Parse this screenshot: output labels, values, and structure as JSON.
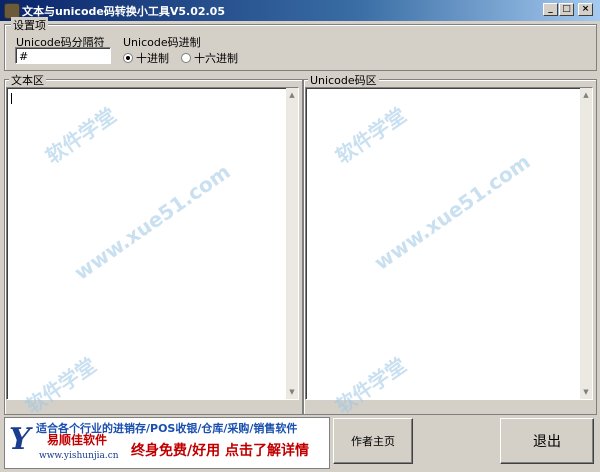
{
  "window": {
    "title": "文本与unicode码转换小工具V5.02.05"
  },
  "settings": {
    "legend": "设置项",
    "separator_label": "Unicode码分隔符",
    "separator_value": "#",
    "radix_label": "Unicode码进制",
    "radix_options": [
      {
        "label": "十进制",
        "selected": true
      },
      {
        "label": "十六进制",
        "selected": false
      }
    ]
  },
  "text_area": {
    "legend": "文本区"
  },
  "unicode_area": {
    "legend": "Unicode码区"
  },
  "watermark": {
    "brand": "软件学堂",
    "url": "www.xue51.com"
  },
  "banner": {
    "line1": "适合各个行业的进销存/POS收银/仓库/采购/销售软件",
    "line2": "终身免费/好用 点击了解详情",
    "logo_letter": "Y",
    "logo_name": "易顺佳软件",
    "logo_url": "www.yishunjia.cn"
  },
  "buttons": {
    "author": "作者主页",
    "exit": "退出"
  },
  "icons": {
    "app": "app-icon",
    "minimize": "minimize-icon",
    "maximize": "maximize-icon",
    "close": "close-icon",
    "scroll_up": "scroll-up-icon",
    "scroll_down": "scroll-down-icon"
  }
}
